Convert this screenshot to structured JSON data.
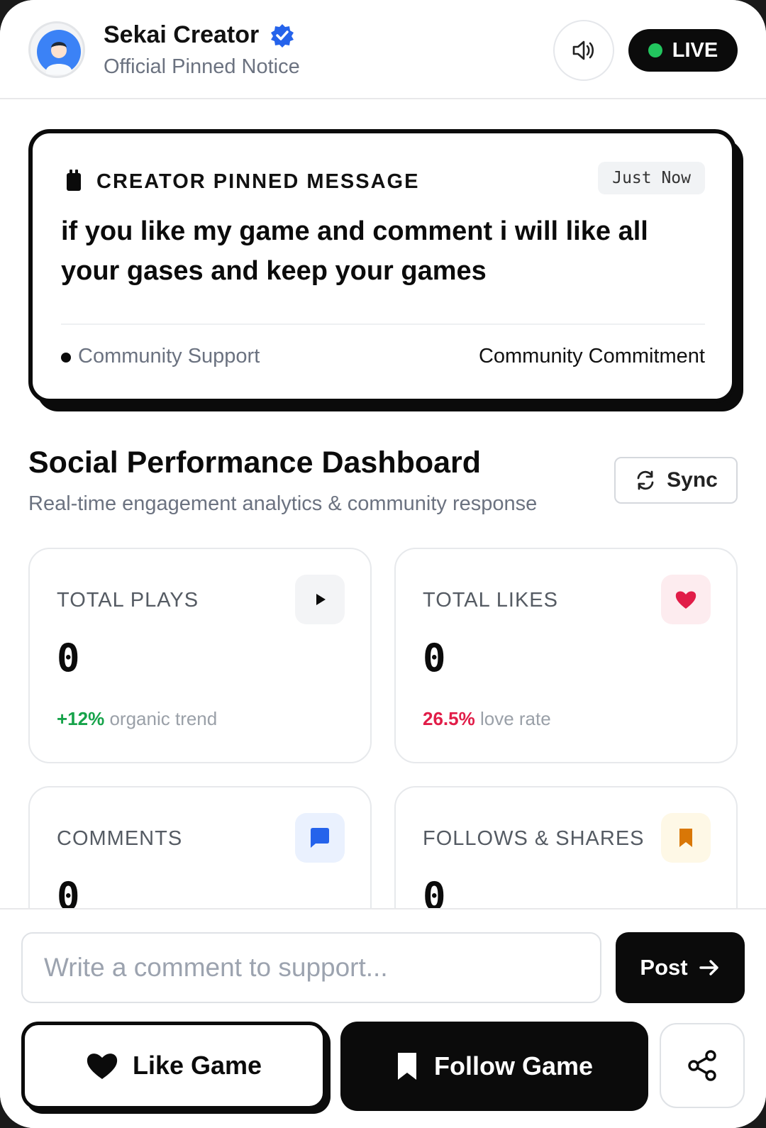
{
  "header": {
    "creator_name": "Sekai Creator",
    "subtitle": "Official Pinned Notice",
    "live_label": "LIVE",
    "icons": [
      "avatar",
      "verified-icon",
      "speaker-icon"
    ]
  },
  "pinned": {
    "title": "CREATOR PINNED MESSAGE",
    "time": "Just Now",
    "message": "if you like my game and comment i will like all your gases and keep your games",
    "tag": "Community Support",
    "commitment": "Community Commitment"
  },
  "dashboard": {
    "title": "Social Performance Dashboard",
    "subtitle": "Real-time engagement analytics & community response",
    "sync_label": "Sync",
    "stats": [
      {
        "label": "TOTAL PLAYS",
        "value": "0",
        "highlight": "+12%",
        "highlight_color": "#16a34a",
        "note": "organic trend",
        "icon": "play-icon"
      },
      {
        "label": "TOTAL LIKES",
        "value": "0",
        "highlight": "26.5%",
        "highlight_color": "#e11d48",
        "note": "love rate",
        "icon": "heart-icon"
      },
      {
        "label": "COMMENTS",
        "value": "0",
        "icon": "comment-icon"
      },
      {
        "label": "FOLLOWS & SHARES",
        "value": "0",
        "icon": "bookmark-icon"
      }
    ]
  },
  "composer": {
    "placeholder": "Write a comment to support...",
    "value": "",
    "post_label": "Post"
  },
  "actions": {
    "like_label": "Like Game",
    "follow_label": "Follow Game",
    "share_icon": "share-icon"
  },
  "colors": {
    "accent": "#0b0b0b",
    "verified": "#2563eb",
    "live_dot": "#22c55e",
    "positive": "#16a34a",
    "love": "#e11d48",
    "comment_blue": "#2563eb",
    "bookmark_orange": "#d97706"
  }
}
